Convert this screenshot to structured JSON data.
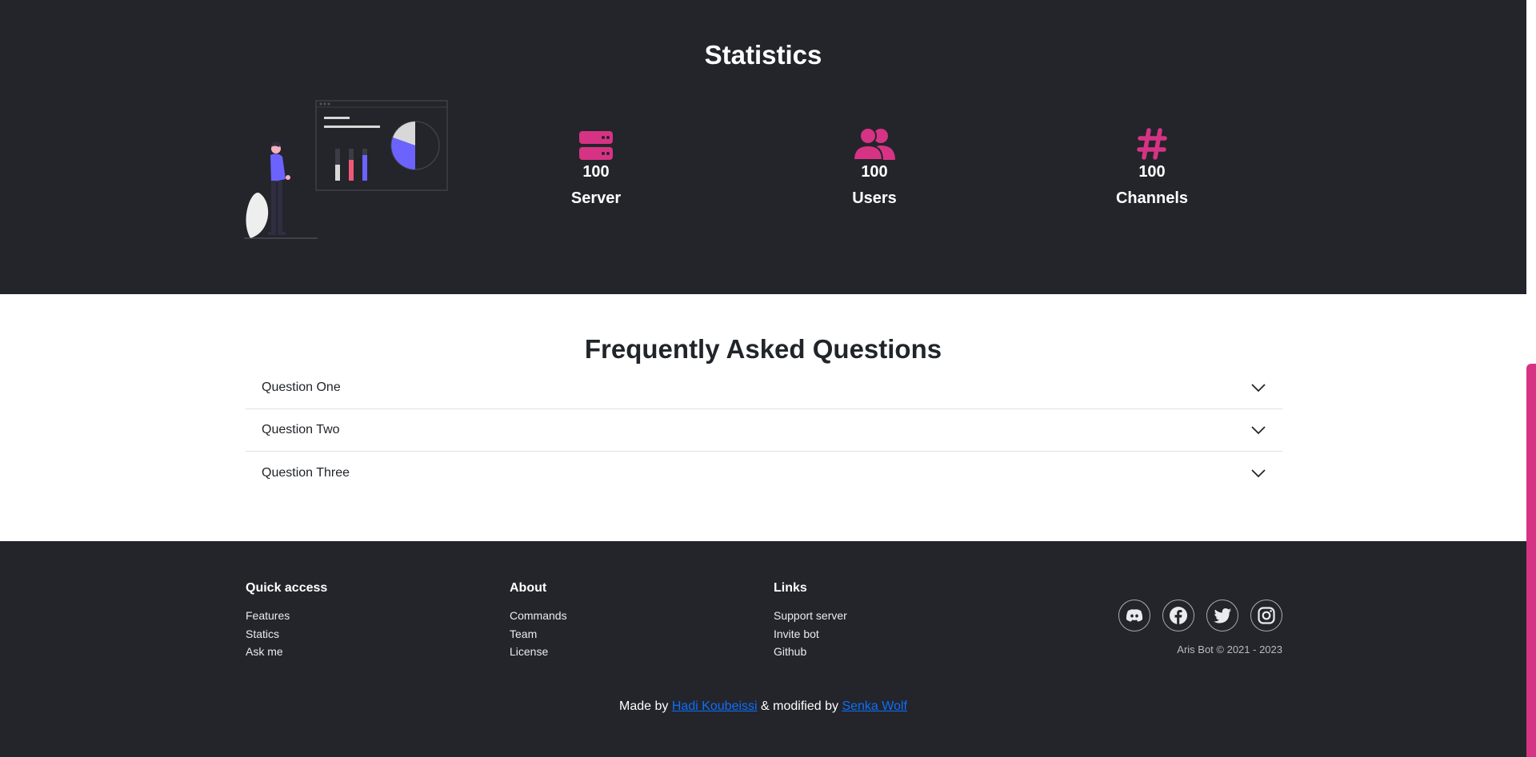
{
  "stats": {
    "title": "Statistics",
    "items": [
      {
        "value": "100",
        "label": "Server",
        "icon": "server-icon"
      },
      {
        "value": "100",
        "label": "Users",
        "icon": "users-icon"
      },
      {
        "value": "100",
        "label": "Channels",
        "icon": "hashtag-icon"
      }
    ]
  },
  "faq": {
    "title": "Frequently Asked Questions",
    "questions": [
      "Question One",
      "Question Two",
      "Question Three"
    ]
  },
  "footer": {
    "quick_access": {
      "title": "Quick access",
      "links": [
        "Features",
        "Statics",
        "Ask me"
      ]
    },
    "about": {
      "title": "About",
      "links": [
        "Commands",
        "Team",
        "License"
      ]
    },
    "links": {
      "title": "Links",
      "links": [
        "Support server",
        "Invite bot",
        "Github"
      ]
    },
    "socials": [
      "discord-icon",
      "facebook-icon",
      "twitter-icon",
      "instagram-icon"
    ],
    "copyright": "Aris Bot © 2021 - 2023",
    "made_by_prefix": "Made by",
    "author": "Hadi Koubeissi",
    "modified_by_text": "& modified by",
    "modifier": "Senka Wolf"
  },
  "colors": {
    "accent": "#d63384",
    "dark_bg": "#23252b",
    "link": "#0d6efd",
    "illus_purple": "#6c63ff",
    "illus_pink": "#f0587a"
  }
}
